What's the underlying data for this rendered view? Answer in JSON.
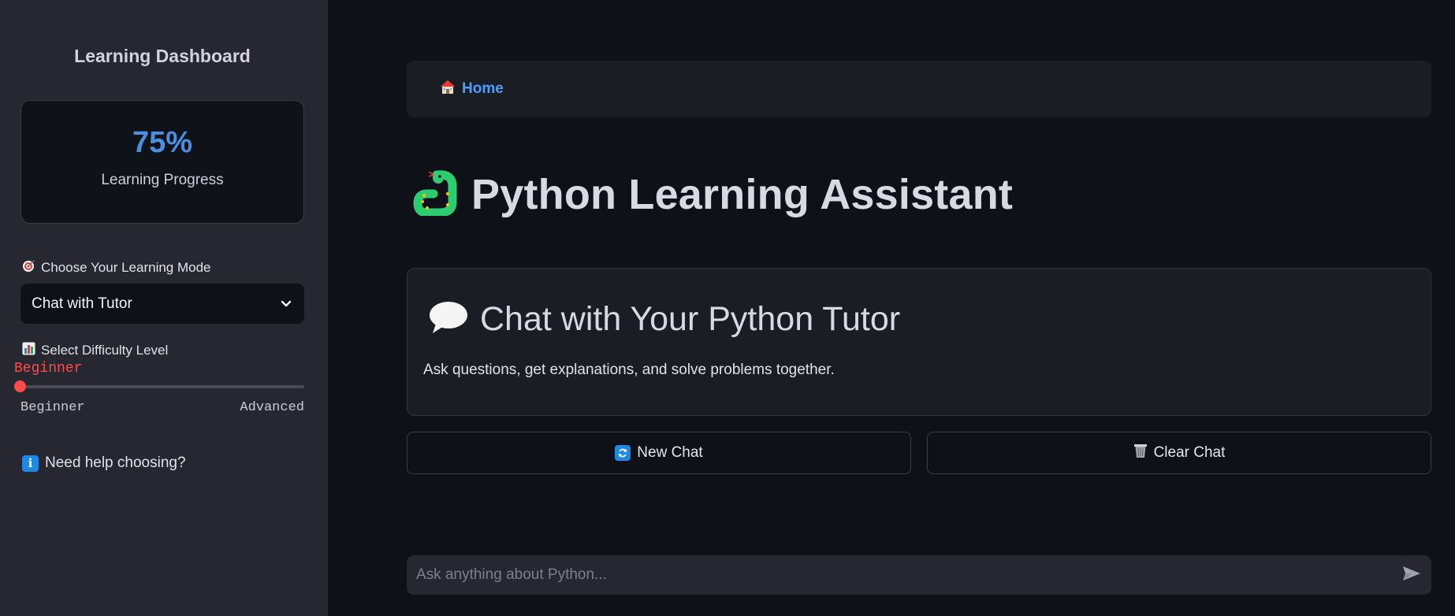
{
  "sidebar": {
    "title": "Learning Dashboard",
    "progress": {
      "value": "75%",
      "label": "Learning Progress"
    },
    "mode": {
      "label": "Choose Your Learning Mode",
      "icon": "target-icon",
      "selected": "Chat with Tutor"
    },
    "difficulty": {
      "label": "Select Difficulty Level",
      "icon": "chart-icon",
      "value": "Beginner",
      "min_label": "Beginner",
      "max_label": "Advanced",
      "position_fraction": 0
    },
    "help": {
      "label": "Need help choosing?",
      "icon": "info-icon"
    }
  },
  "breadcrumb": {
    "icon": "house-icon",
    "label": "Home"
  },
  "page": {
    "title": "Python Learning Assistant",
    "icon": "snake-icon"
  },
  "chat_card": {
    "icon": "speech-bubble-icon",
    "title": "Chat with Your Python Tutor",
    "description": "Ask questions, get explanations, and solve problems together."
  },
  "buttons": {
    "new_chat": {
      "label": "New Chat",
      "icon": "refresh-icon"
    },
    "clear_chat": {
      "label": "Clear Chat",
      "icon": "wastebasket-icon"
    }
  },
  "chat_input": {
    "placeholder": "Ask anything about Python...",
    "value": "",
    "send_icon": "send-icon"
  },
  "colors": {
    "accent_blue": "#4a90e2",
    "slider_red": "#ff4b4b",
    "sidebar_bg": "#262730",
    "main_bg": "#0e1117"
  }
}
